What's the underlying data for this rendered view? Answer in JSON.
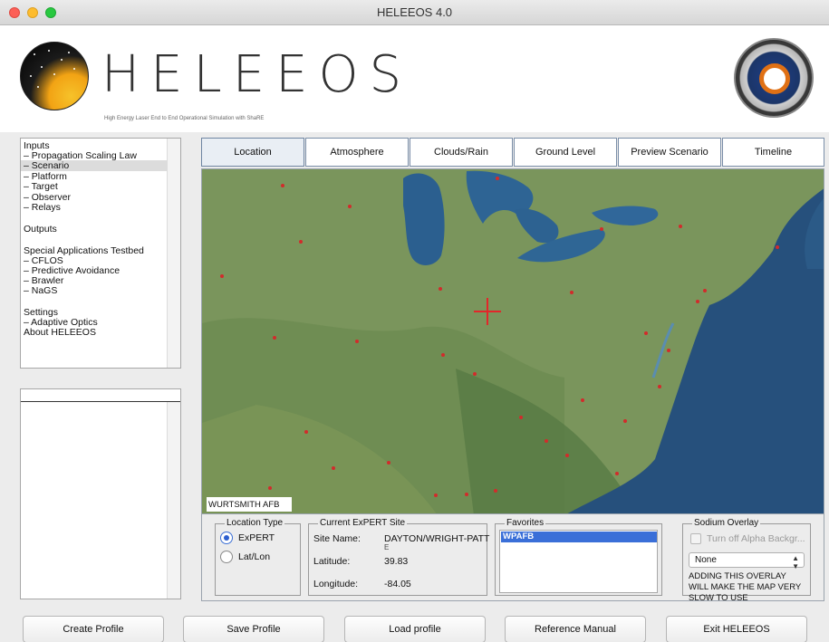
{
  "window": {
    "title": "HELEEOS 4.0"
  },
  "header": {
    "brand": "HELEEOS",
    "subtitle": "High Energy Laser End to End Operational Simulation with ShaRE"
  },
  "nav": {
    "items": [
      {
        "label": "Inputs"
      },
      {
        "label": " – Propagation Scaling Law"
      },
      {
        "label": " – Scenario",
        "selected": true
      },
      {
        "label": " – Platform"
      },
      {
        "label": " – Target"
      },
      {
        "label": " – Observer"
      },
      {
        "label": " – Relays"
      },
      {
        "label": "Outputs"
      },
      {
        "label": "Special Applications Testbed"
      },
      {
        "label": " – CFLOS"
      },
      {
        "label": " – Predictive Avoidance"
      },
      {
        "label": " – Brawler"
      },
      {
        "label": " – NaGS"
      },
      {
        "label": "Settings"
      },
      {
        "label": " – Adaptive Optics"
      },
      {
        "label": "About HELEEOS"
      }
    ]
  },
  "tabs": [
    {
      "label": "Location",
      "active": true
    },
    {
      "label": "Atmosphere"
    },
    {
      "label": "Clouds/Rain"
    },
    {
      "label": "Ground Level"
    },
    {
      "label": "Preview Scenario"
    },
    {
      "label": "Timeline"
    }
  ],
  "map": {
    "hover_label": "WURTSMITH AFB"
  },
  "location_type": {
    "title": "Location Type",
    "options": [
      {
        "label": "ExPERT",
        "selected": true
      },
      {
        "label": "Lat/Lon",
        "selected": false
      }
    ]
  },
  "current_site": {
    "title": "Current ExPERT Site",
    "site_name_label": "Site Name:",
    "site_name_value": "DAYTON/WRIGHT-PATT",
    "site_name_wrap": "E",
    "latitude_label": "Latitude:",
    "latitude_value": "39.83",
    "longitude_label": "Longitude:",
    "longitude_value": "-84.05"
  },
  "favorites": {
    "title": "Favorites",
    "items": [
      "WPAFB"
    ]
  },
  "sodium": {
    "title": "Sodium Overlay",
    "checkbox_label": "Turn off Alpha Backgr...",
    "select_value": "None",
    "warning": "ADDING THIS OVERLAY WILL MAKE THE MAP VERY SLOW TO USE"
  },
  "buttons": {
    "create": "Create Profile",
    "save": "Save Profile",
    "load": "Load profile",
    "manual": "Reference Manual",
    "exit": "Exit HELEEOS"
  }
}
